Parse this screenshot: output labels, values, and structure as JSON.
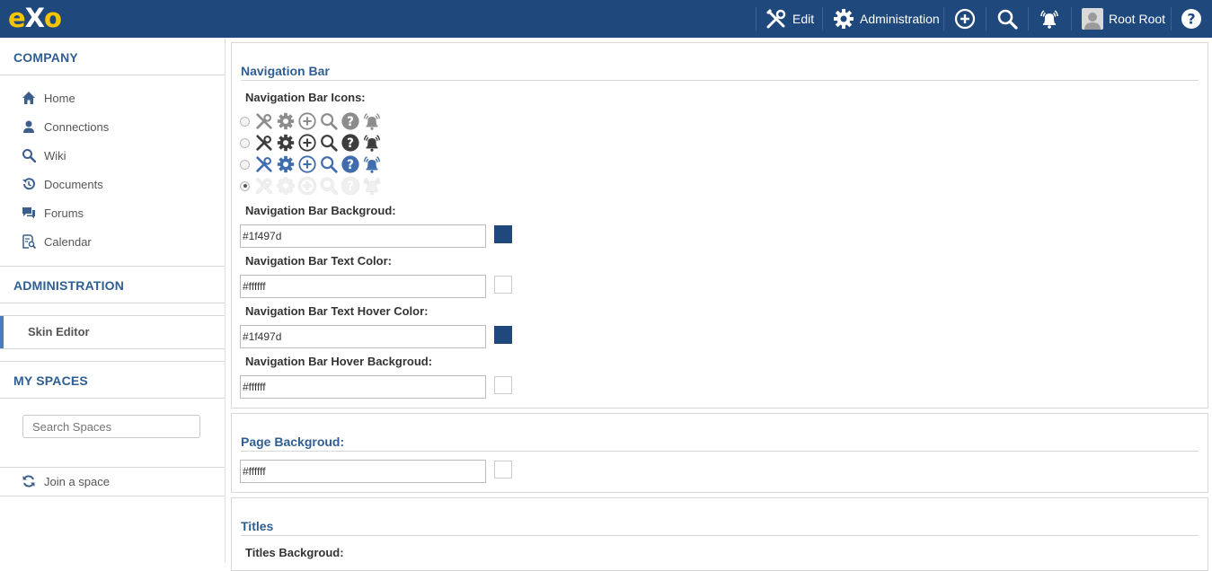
{
  "topbar": {
    "logo_e": "e",
    "logo_x": "X",
    "logo_o": "o",
    "edit_label": "Edit",
    "admin_label": "Administration",
    "user_label": "Root Root",
    "bg_color": "#1f497d"
  },
  "sidebar": {
    "company_heading": "COMPANY",
    "items": [
      {
        "label": "Home",
        "icon": "home-icon"
      },
      {
        "label": "Connections",
        "icon": "user-icon"
      },
      {
        "label": "Wiki",
        "icon": "search-icon"
      },
      {
        "label": "Documents",
        "icon": "history-icon"
      },
      {
        "label": "Forums",
        "icon": "chat-icon"
      },
      {
        "label": "Calendar",
        "icon": "calendar-search-icon"
      }
    ],
    "admin_heading": "ADMINISTRATION",
    "skin_editor_label": "Skin Editor",
    "spaces_heading": "MY SPACES",
    "search_placeholder": "Search Spaces",
    "join_label": "Join a space"
  },
  "navbar_section": {
    "title": "Navigation Bar",
    "icons_label": "Navigation Bar Icons:",
    "icon_sets": [
      {
        "color": "#8c8c8c",
        "selected": false
      },
      {
        "color": "#3d3d3d",
        "selected": false
      },
      {
        "color": "#3f6dad",
        "selected": false
      },
      {
        "color": "#f0f0f0",
        "selected": true
      }
    ],
    "background_label": "Navigation Bar Backgroud:",
    "background_value": "#1f497d",
    "text_color_label": "Navigation Bar Text Color:",
    "text_color_value": "#ffffff",
    "hover_text_label": "Navigation Bar Text Hover Color:",
    "hover_text_value": "#1f497d",
    "hover_bg_label": "Navigation Bar Hover Backgroud:",
    "hover_bg_value": "#ffffff"
  },
  "page_section": {
    "title": "Page Backgroud:",
    "value": "#ffffff"
  },
  "titles_section": {
    "title": "Titles",
    "background_label": "Titles Backgroud:"
  }
}
